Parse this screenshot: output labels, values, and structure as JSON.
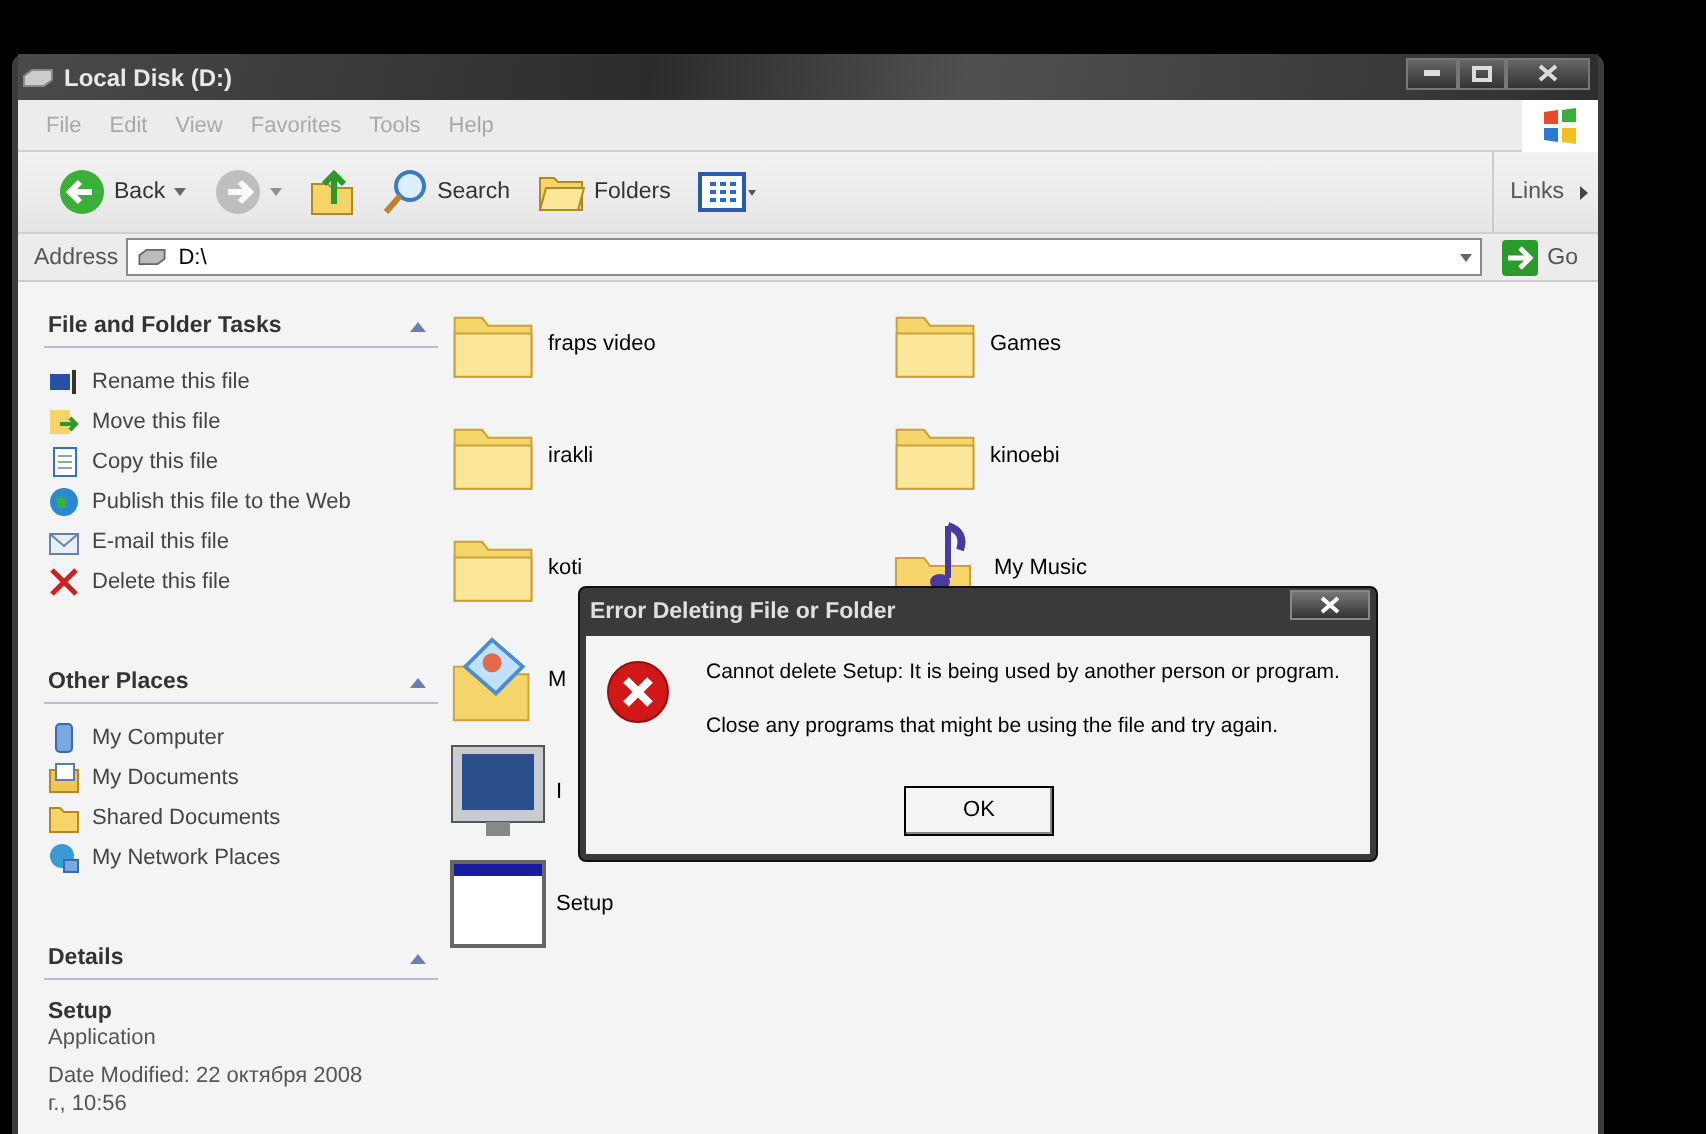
{
  "window": {
    "title": "Local Disk (D:)"
  },
  "menu": [
    "File",
    "Edit",
    "View",
    "Favorites",
    "Tools",
    "Help"
  ],
  "toolbar": [
    {
      "kind": "back",
      "label": "Back",
      "disabled": false
    },
    {
      "kind": "forward",
      "disabled": true
    },
    {
      "kind": "up",
      "disabled": false
    },
    {
      "kind": "search",
      "label": "Search",
      "disabled": false
    },
    {
      "kind": "folders",
      "label": "Folders",
      "disabled": false
    },
    {
      "kind": "views",
      "disabled": false
    }
  ],
  "links": {
    "label": "Links"
  },
  "address": {
    "label": "Address",
    "value": "D:\\",
    "go": "Go"
  },
  "sidebar": {
    "sections": [
      {
        "kind": "tasks",
        "title": "File and Folder Tasks",
        "expanded": true,
        "items": [
          {
            "kind": "rename",
            "label": "Rename this file"
          },
          {
            "kind": "move",
            "label": "Move this file"
          },
          {
            "kind": "copy",
            "label": "Copy this file"
          },
          {
            "kind": "web",
            "label": "Publish this file to the Web"
          },
          {
            "kind": "mail",
            "label": "E-mail this file"
          },
          {
            "kind": "delete",
            "label": "Delete this file"
          }
        ]
      },
      {
        "kind": "places",
        "title": "Other Places",
        "expanded": true,
        "items": [
          {
            "kind": "computer",
            "label": "My Computer"
          },
          {
            "kind": "documents",
            "label": "My Documents"
          },
          {
            "kind": "folder",
            "label": "Shared Documents"
          },
          {
            "kind": "network",
            "label": "My Network Places"
          }
        ]
      },
      {
        "kind": "details",
        "title": "Details",
        "expanded": true,
        "name": "Setup",
        "type": "Application",
        "modified": "Date Modified: 22 октября 2008 г., 10:56"
      }
    ]
  },
  "files": [
    {
      "kind": "folder",
      "name": "fraps video"
    },
    {
      "kind": "folder",
      "name": "Games"
    },
    {
      "kind": "folder",
      "name": "irakli"
    },
    {
      "kind": "folder",
      "name": "kinoebi"
    },
    {
      "kind": "folder",
      "name": "koti"
    },
    {
      "kind": "music",
      "name": "My Music"
    },
    {
      "kind": "pictures",
      "name": "M"
    },
    {
      "kind": "none"
    },
    {
      "kind": "program",
      "name": "I"
    },
    {
      "kind": "none"
    },
    {
      "kind": "setup",
      "name": "Setup"
    }
  ],
  "dialog": {
    "title": "Error Deleting File or Folder",
    "lines": [
      "Cannot delete Setup: It is being used by another person or program.",
      "Close any programs that might be using the file and try again."
    ],
    "button": "OK"
  }
}
